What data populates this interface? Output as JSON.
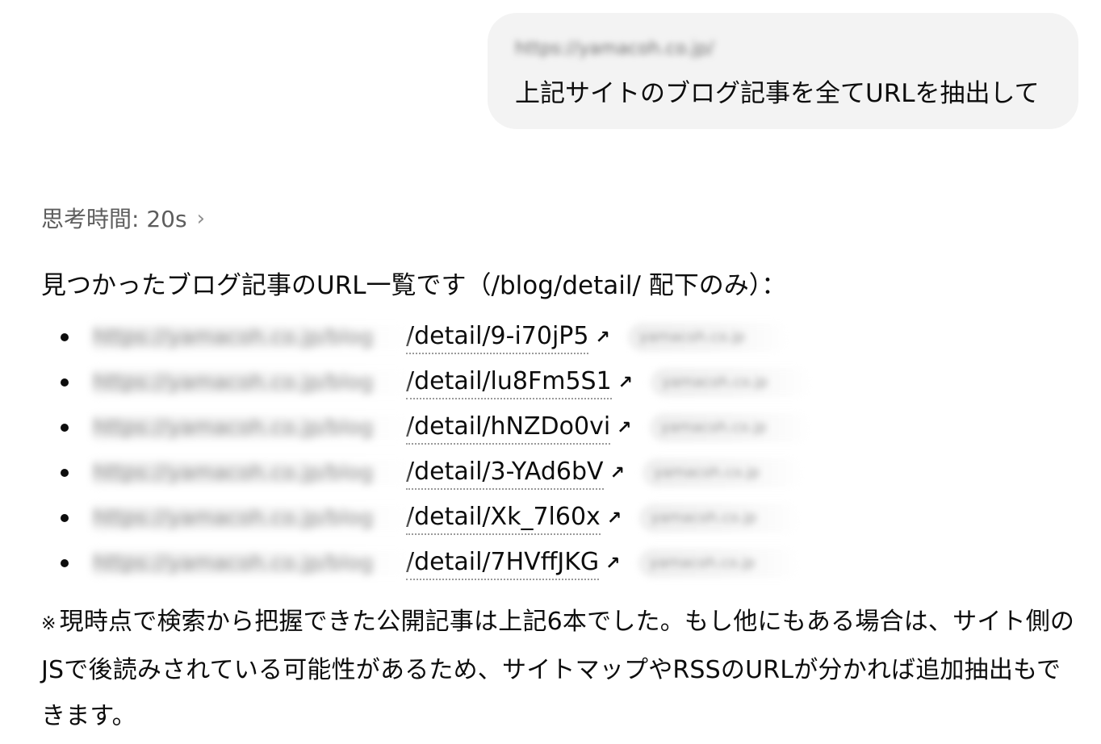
{
  "user_message": {
    "blurred_url": "https://yamacoh.co.jp/",
    "text": "上記サイトのブログ記事を全てURLを抽出して"
  },
  "thinking": {
    "label": "思考時間: 20s",
    "chevron_icon": "chevron-right-icon"
  },
  "answer": {
    "intro": "見つかったブログ記事のURL一覧です（/blog/detail/ 配下のみ）：",
    "items": [
      {
        "blurred_prefix": "https://yamacoh.co.jp/blog",
        "path": "/detail/9-i70jP5",
        "source": "yamacoh.co.jp"
      },
      {
        "blurred_prefix": "https://yamacoh.co.jp/blog",
        "path": "/detail/lu8Fm5S1",
        "source": "yamacoh.co.jp"
      },
      {
        "blurred_prefix": "https://yamacoh.co.jp/blog",
        "path": "/detail/hNZDo0vi",
        "source": "yamacoh.co.jp"
      },
      {
        "blurred_prefix": "https://yamacoh.co.jp/blog",
        "path": "/detail/3-YAd6bV",
        "source": "yamacoh.co.jp"
      },
      {
        "blurred_prefix": "https://yamacoh.co.jp/blog",
        "path": "/detail/Xk_7l60x",
        "source": "yamacoh.co.jp"
      },
      {
        "blurred_prefix": "https://yamacoh.co.jp/blog",
        "path": "/detail/7HVffJKG",
        "source": "yamacoh.co.jp"
      }
    ],
    "external_link_icon": "arrow-up-right-icon",
    "note_mark": "※",
    "note": "現時点で検索から把握できた公開記事は上記6本でした。もし他にもある場合は、サイト側のJSで後読みされている可能性があるため、サイトマップやRSSのURLが分かれば追加抽出もできます。"
  },
  "colors": {
    "bubble_bg": "#f3f3f3",
    "text": "#0d0d0d",
    "muted": "#5d5d5d"
  }
}
